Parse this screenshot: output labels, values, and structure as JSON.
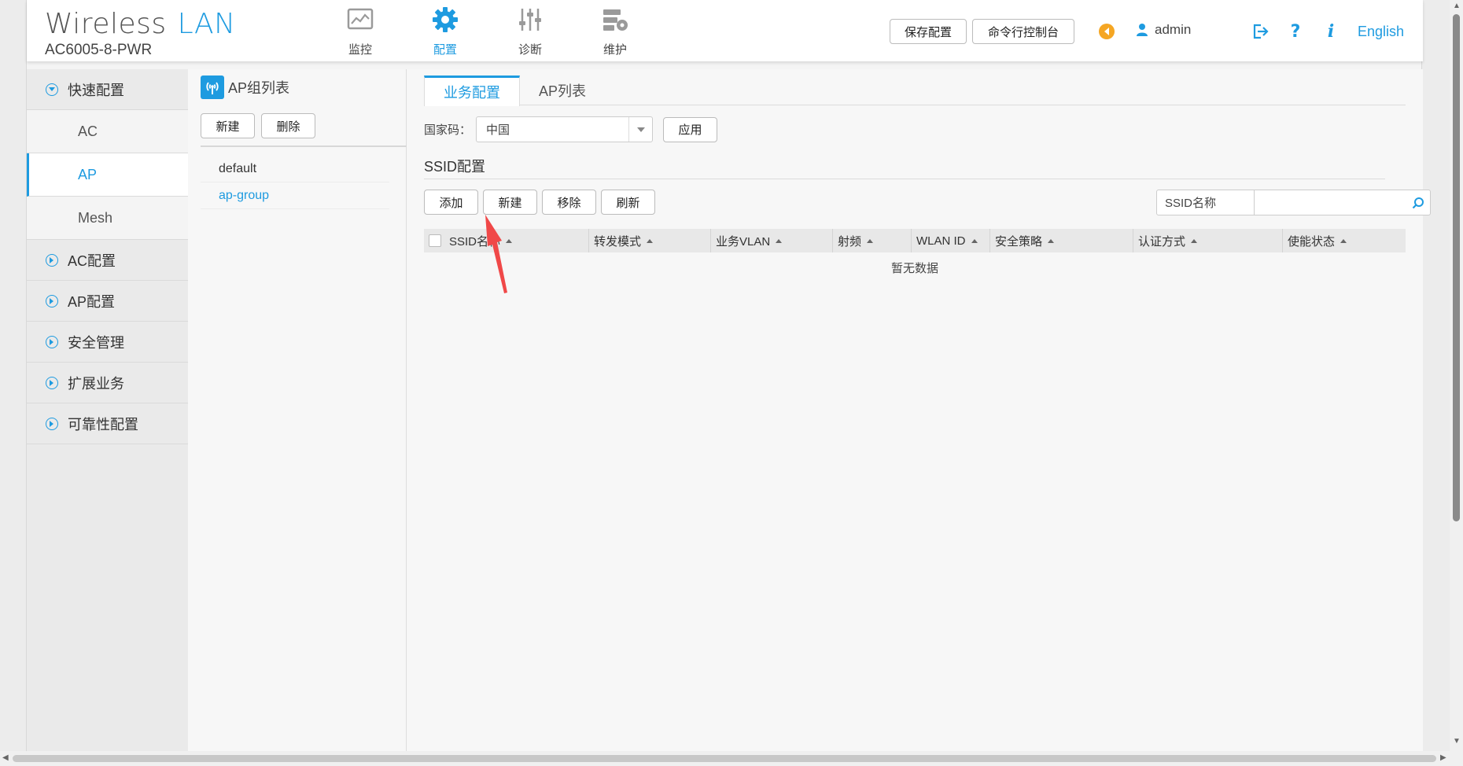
{
  "header": {
    "brand_title": "Wireless",
    "brand_title_accent": "LAN",
    "model": "AC6005-8-PWR",
    "nav": [
      {
        "label": "监控",
        "icon": "monitor-icon"
      },
      {
        "label": "配置",
        "icon": "gear-icon"
      },
      {
        "label": "诊断",
        "icon": "sliders-icon"
      },
      {
        "label": "维护",
        "icon": "maintenance-icon"
      }
    ],
    "save_config": "保存配置",
    "cli_console": "命令行控制台",
    "user": "admin",
    "language": "English"
  },
  "sidebar": {
    "quick_config": "快速配置",
    "sub_items": [
      {
        "label": "AC"
      },
      {
        "label": "AP"
      },
      {
        "label": "Mesh"
      }
    ],
    "sections": [
      {
        "label": "AC配置"
      },
      {
        "label": "AP配置"
      },
      {
        "label": "安全管理"
      },
      {
        "label": "扩展业务"
      },
      {
        "label": "可靠性配置"
      }
    ]
  },
  "ap_groups": {
    "title": "AP组列表",
    "new_btn": "新建",
    "delete_btn": "删除",
    "items": [
      {
        "label": "default"
      },
      {
        "label": "ap-group"
      }
    ]
  },
  "main": {
    "tabs": [
      {
        "label": "业务配置"
      },
      {
        "label": "AP列表"
      }
    ],
    "country_label": "国家码：",
    "country_value": "中国",
    "apply_btn": "应用",
    "section_title": "SSID配置",
    "buttons": {
      "add": "添加",
      "new": "新建",
      "remove": "移除",
      "refresh": "刷新"
    },
    "search_label": "SSID名称",
    "search_value": "",
    "columns": [
      {
        "label": "SSID名称"
      },
      {
        "label": "转发模式"
      },
      {
        "label": "业务VLAN"
      },
      {
        "label": "射频"
      },
      {
        "label": "WLAN ID"
      },
      {
        "label": "安全策略"
      },
      {
        "label": "认证方式"
      },
      {
        "label": "使能状态"
      }
    ],
    "empty_text": "暂无数据"
  },
  "colors": {
    "accent": "#1e9be0",
    "annotation": "#f04848",
    "notice": "#f5a623"
  }
}
